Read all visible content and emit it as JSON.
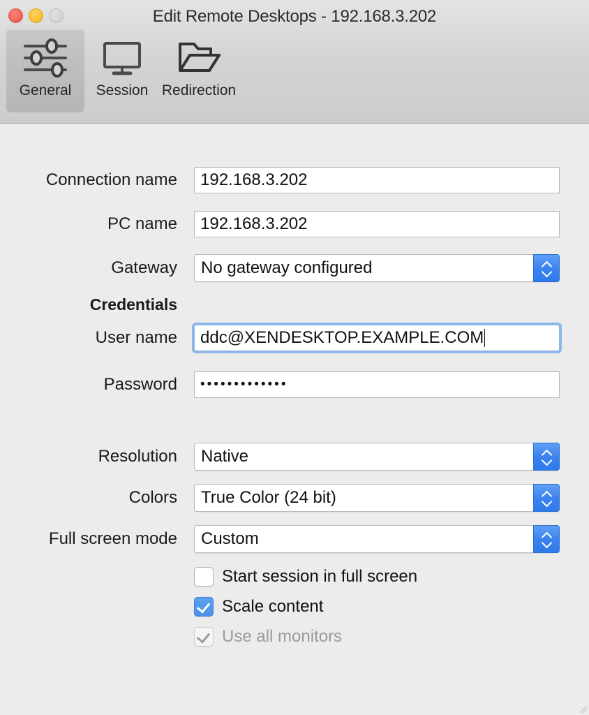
{
  "window": {
    "title": "Edit Remote Desktops - 192.168.3.202",
    "traffic_lights": [
      {
        "name": "close",
        "color": "#ef6a5f"
      },
      {
        "name": "minimize",
        "color": "#f7c13c"
      },
      {
        "name": "zoom",
        "color": "#d6d6d6"
      }
    ]
  },
  "toolbar": {
    "items": [
      {
        "label": "General",
        "icon": "sliders-icon",
        "selected": true
      },
      {
        "label": "Session",
        "icon": "monitor-icon",
        "selected": false
      },
      {
        "label": "Redirection",
        "icon": "open-folder-icon",
        "selected": false
      }
    ]
  },
  "form": {
    "connection_name": {
      "label": "Connection name",
      "value": "192.168.3.202",
      "placeholder": ""
    },
    "pc_name": {
      "label": "PC name",
      "value": "192.168.3.202",
      "placeholder": ""
    },
    "gateway": {
      "label": "Gateway",
      "value": "No gateway configured",
      "options": [
        "No gateway configured"
      ]
    },
    "credentials_heading": "Credentials",
    "user_name": {
      "label": "User name",
      "value": "ddc@XENDESKTOP.EXAMPLE.COM",
      "placeholder": "",
      "focused": true
    },
    "password": {
      "label": "Password",
      "value": "•••••••••••••",
      "placeholder": ""
    },
    "resolution": {
      "label": "Resolution",
      "value": "Native",
      "options": [
        "Native"
      ]
    },
    "colors": {
      "label": "Colors",
      "value": "True Color (24 bit)",
      "options": [
        "True Color (24 bit)"
      ]
    },
    "full_screen_mode": {
      "label": "Full screen mode",
      "value": "Custom",
      "options": [
        "Custom"
      ]
    },
    "checkboxes": [
      {
        "label": "Start session in full screen",
        "checked": false,
        "disabled": false
      },
      {
        "label": "Scale content",
        "checked": true,
        "disabled": false
      },
      {
        "label": "Use all monitors",
        "checked": true,
        "disabled": true
      }
    ]
  },
  "colors": {
    "accent": "#4a90e8",
    "stepper": "#3d83ee",
    "focus_ring": "#6ca4e7",
    "toolbar_bg": "#d4d4d4",
    "body_bg": "#ececec"
  }
}
